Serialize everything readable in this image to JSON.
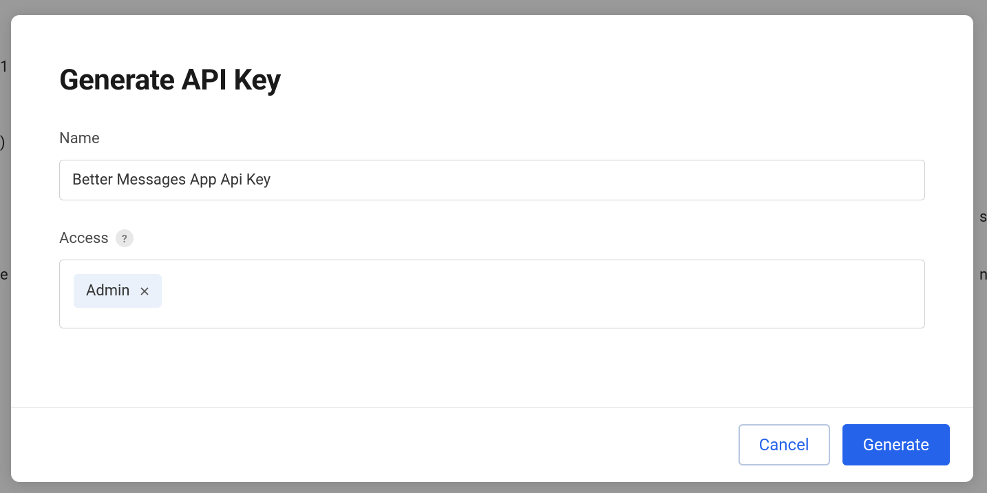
{
  "modal": {
    "title": "Generate API Key",
    "fields": {
      "name": {
        "label": "Name",
        "value": "Better Messages App Api Key"
      },
      "access": {
        "label": "Access",
        "help_symbol": "?",
        "tags": [
          {
            "label": "Admin"
          }
        ]
      }
    },
    "footer": {
      "cancel_label": "Cancel",
      "generate_label": "Generate"
    }
  },
  "backdrop": {
    "bt1": "1",
    "bt2": ")",
    "bt3": "s",
    "bt4": "e",
    "bt5": "n"
  }
}
